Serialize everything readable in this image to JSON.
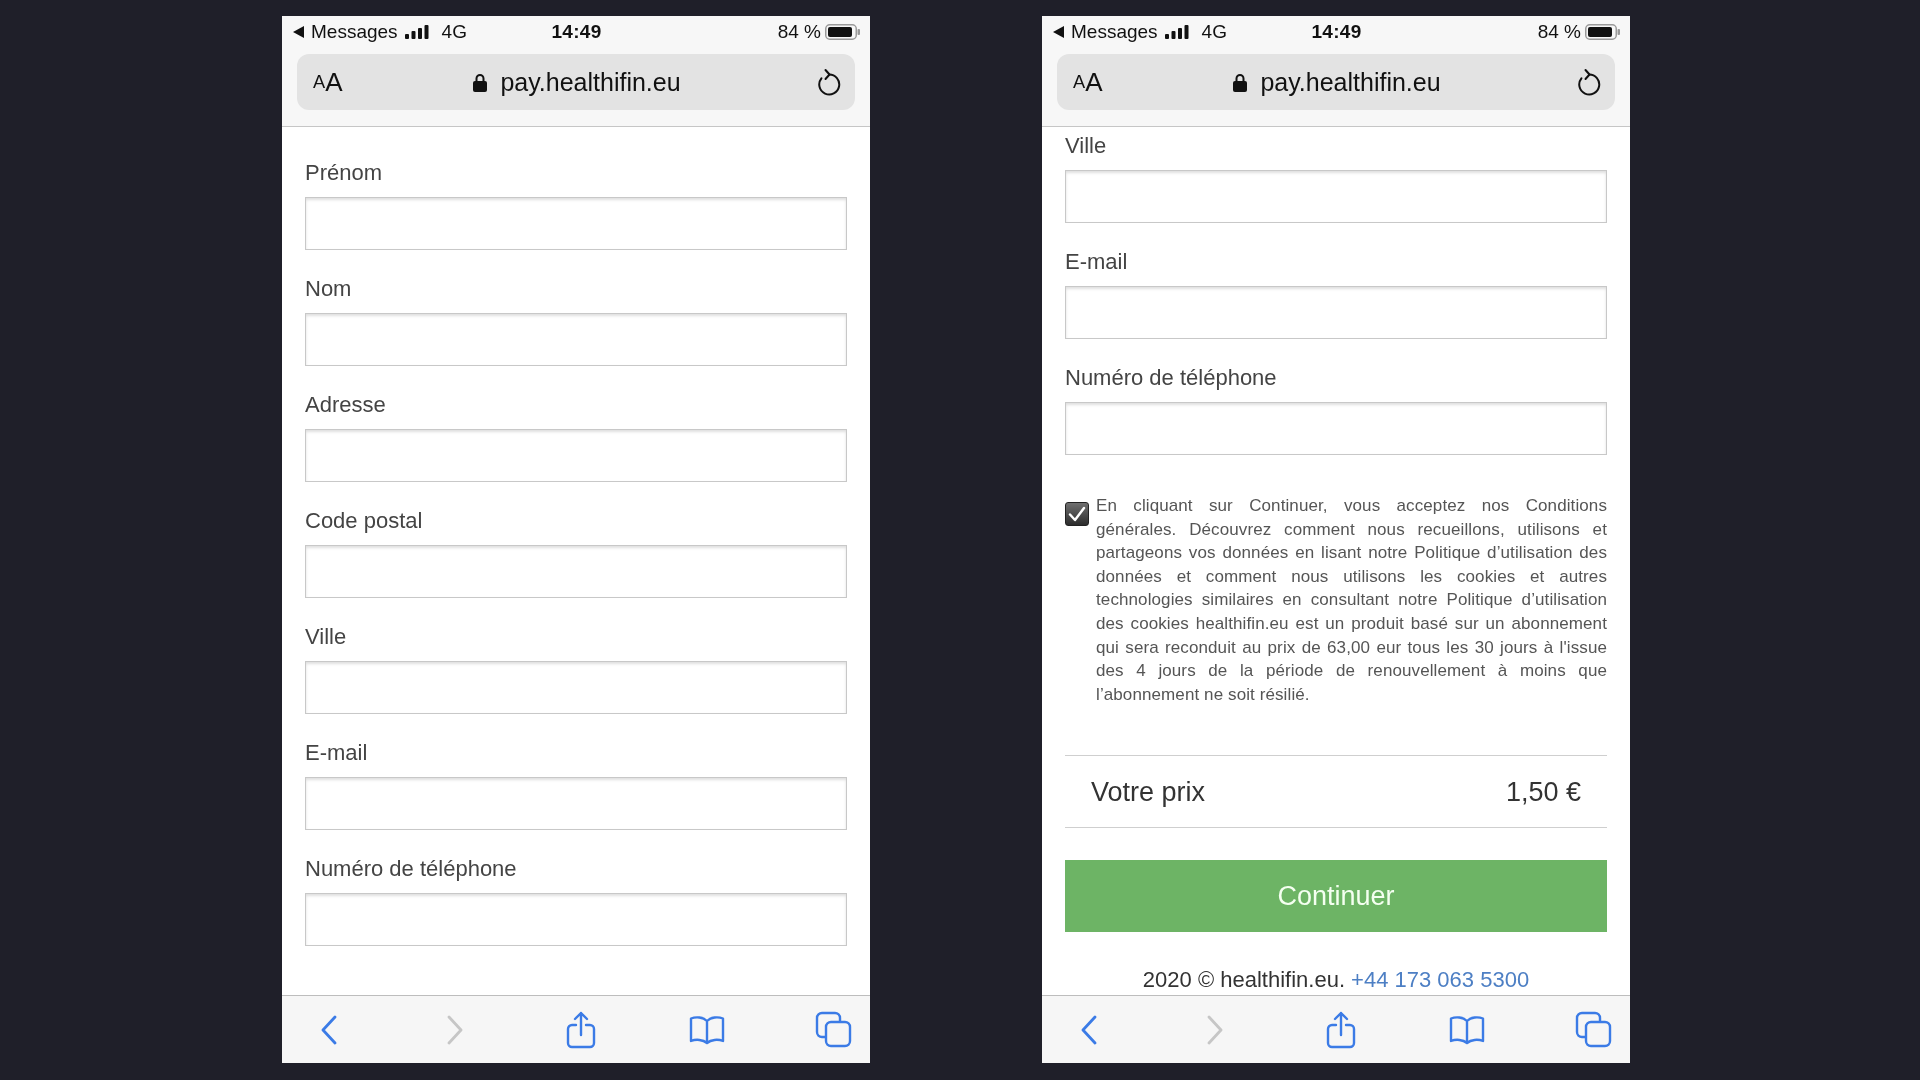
{
  "screens": [
    {
      "status_bar": {
        "back_app": "Messages",
        "network": "4G",
        "time": "14:49",
        "battery": "84 %"
      },
      "address_bar": {
        "text_size": "$_{A}$A",
        "secure": true,
        "url": "pay.healthifin.eu"
      },
      "form": {
        "fields": [
          {
            "label": "Prénom"
          },
          {
            "label": "Nom"
          },
          {
            "label": "Adresse"
          },
          {
            "label": "Code postal"
          },
          {
            "label": "Ville"
          },
          {
            "label": "E-mail"
          },
          {
            "label": "Numéro de téléphone"
          }
        ]
      },
      "toolbar": {
        "buttons": [
          {
            "kind": "back",
            "disabled": false
          },
          {
            "kind": "forward",
            "disabled": true
          },
          {
            "kind": "share",
            "disabled": false
          },
          {
            "kind": "bookmarks",
            "disabled": false
          },
          {
            "kind": "tabs",
            "disabled": false
          }
        ]
      }
    },
    {
      "status_bar": {
        "back_app": "Messages",
        "network": "4G",
        "time": "14:49",
        "battery": "84 %"
      },
      "address_bar": {
        "text_size": "$_{A}$A",
        "secure": true,
        "url": "pay.healthifin.eu"
      },
      "form": {
        "fields": [
          {
            "label": "Ville"
          },
          {
            "label": "E-mail"
          },
          {
            "label": "Numéro de téléphone"
          }
        ],
        "consent": {
          "checked": true,
          "text": "En cliquant sur Continuer, vous acceptez nos Conditions générales. Découvrez comment nous recueillons, utilisons et partageons vos données en lisant notre Politique d’utilisation des données et comment nous utilisons les cookies et autres technologies similaires en consultant notre Politique d’utilisation des cookies healthifin.eu est un produit basé sur un abonnement qui sera reconduit au prix de 63,00 eur tous les 30 jours à l'issue des 4 jours de la période de renouvellement à moins que l’abonnement ne soit résilié."
        },
        "price": {
          "label": "Votre prix",
          "value": "1,50 €"
        },
        "submit": "Continuer",
        "footer": {
          "text": "2020 © healthifin.eu.",
          "phone": "+44 173 063 5300"
        }
      },
      "toolbar": {
        "buttons": [
          {
            "kind": "back",
            "disabled": false
          },
          {
            "kind": "forward",
            "disabled": true
          },
          {
            "kind": "share",
            "disabled": false
          },
          {
            "kind": "bookmarks",
            "disabled": false
          },
          {
            "kind": "tabs",
            "disabled": false
          }
        ]
      }
    }
  ]
}
